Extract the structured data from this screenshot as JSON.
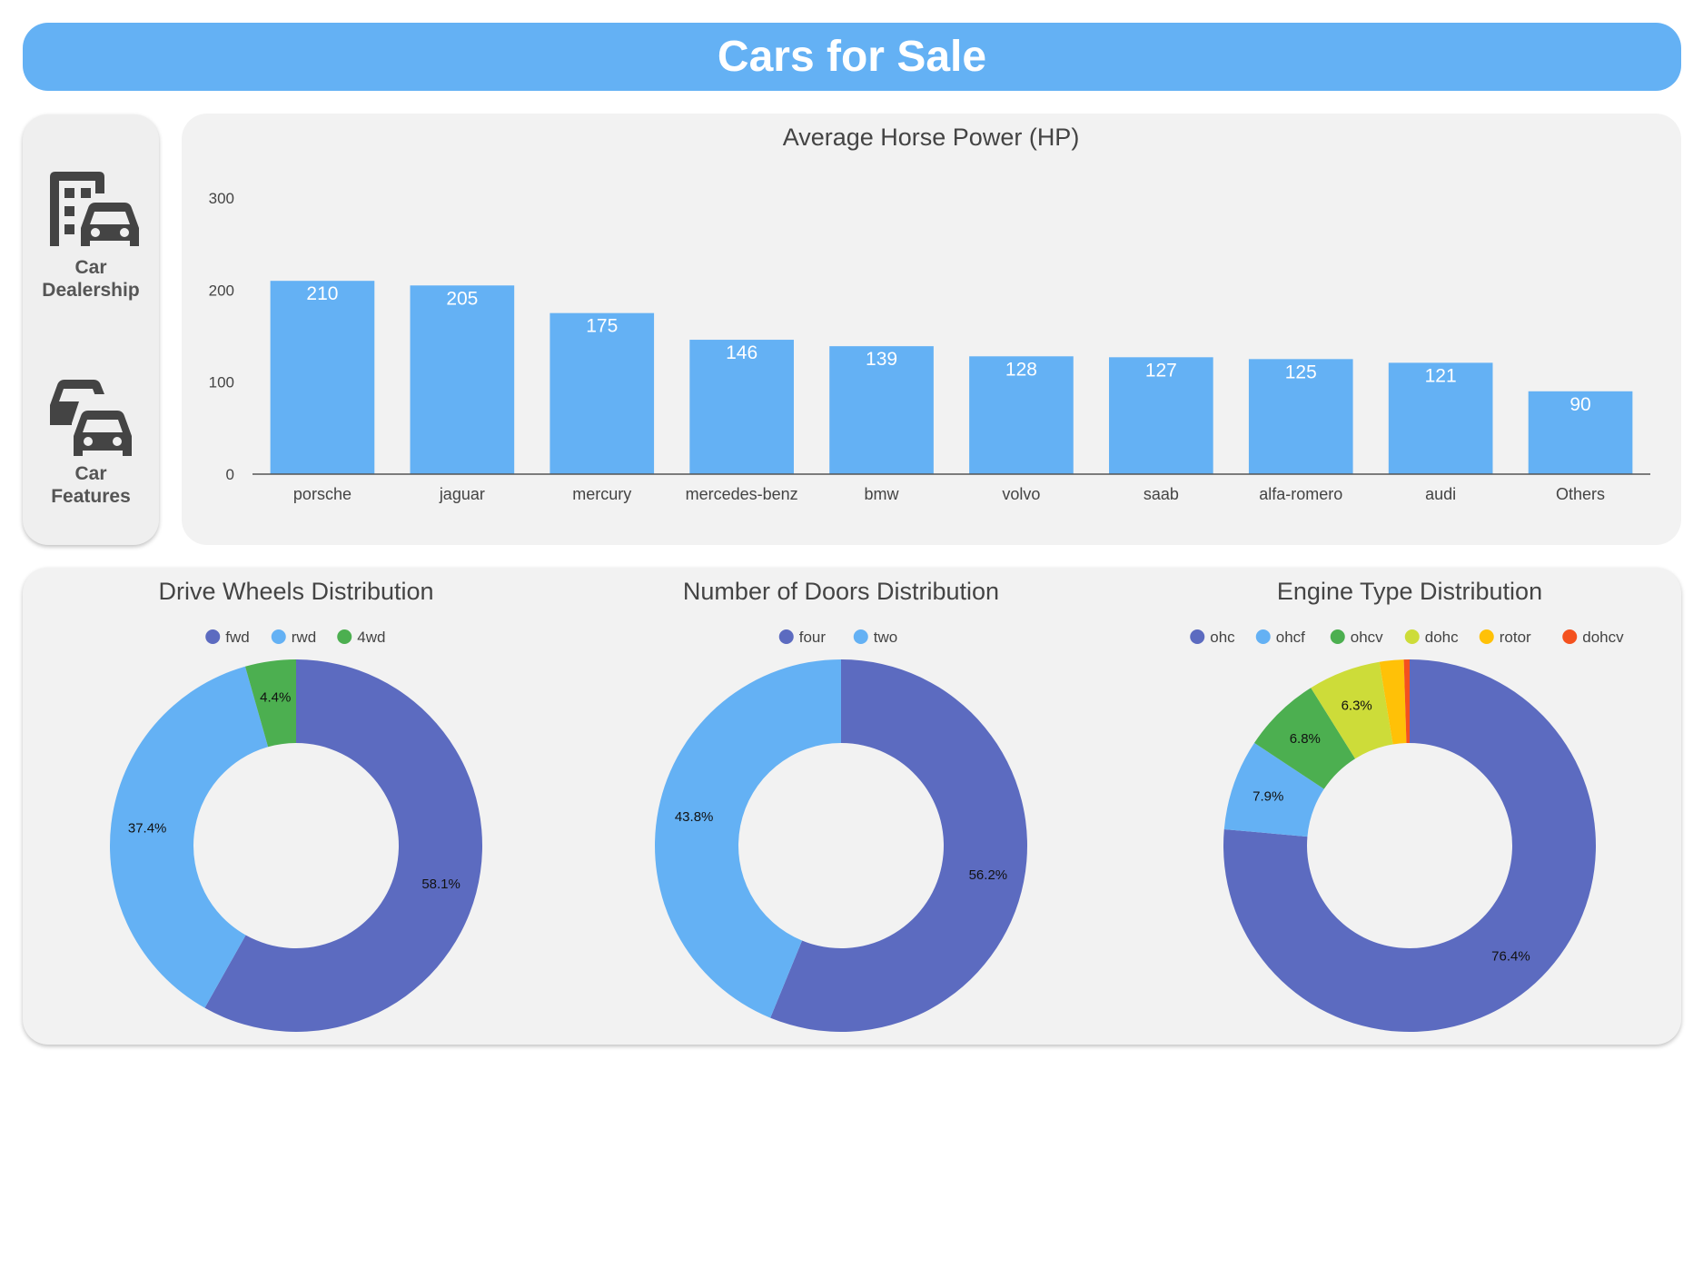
{
  "header": {
    "title": "Cars for Sale"
  },
  "sidebar": {
    "items": [
      {
        "label_line1": "Car",
        "label_line2": "Dealership",
        "icon": "building-car-icon"
      },
      {
        "label_line1": "Car",
        "label_line2": "Features",
        "icon": "cars-icon"
      }
    ]
  },
  "colors": {
    "accent": "#64b1f4",
    "bar": "#64b1f4",
    "panel": "#f2f2f2"
  },
  "chart_data": [
    {
      "type": "bar",
      "title": "Average Horse Power (HP)",
      "categories": [
        "porsche",
        "jaguar",
        "mercury",
        "mercedes-benz",
        "bmw",
        "volvo",
        "saab",
        "alfa-romero",
        "audi",
        "Others"
      ],
      "values": [
        210,
        205,
        175,
        146,
        139,
        128,
        127,
        125,
        121,
        90
      ],
      "ylim": [
        0,
        300
      ],
      "yticks": [
        0,
        100,
        200,
        300
      ],
      "data_labels": true,
      "grid": false,
      "color": "#64b1f4"
    },
    {
      "type": "pie",
      "donut": true,
      "title": "Drive Wheels Distribution",
      "legend_position": "top",
      "slices": [
        {
          "label": "fwd",
          "value": 58.1,
          "display": "58.1%",
          "color": "#5c6bc0"
        },
        {
          "label": "rwd",
          "value": 37.4,
          "display": "37.4%",
          "color": "#64b1f4"
        },
        {
          "label": "4wd",
          "value": 4.4,
          "display": "4.4%",
          "color": "#4caf50"
        }
      ]
    },
    {
      "type": "pie",
      "donut": true,
      "title": "Number of Doors Distribution",
      "legend_position": "top",
      "slices": [
        {
          "label": "four",
          "value": 56.2,
          "display": "56.2%",
          "color": "#5c6bc0"
        },
        {
          "label": "two",
          "value": 43.8,
          "display": "43.8%",
          "color": "#64b1f4"
        }
      ]
    },
    {
      "type": "pie",
      "donut": true,
      "title": "Engine Type Distribution",
      "legend_position": "top",
      "slices": [
        {
          "label": "ohc",
          "value": 76.4,
          "display": "76.4%",
          "color": "#5c6bc0"
        },
        {
          "label": "ohcf",
          "value": 7.9,
          "display": "7.9%",
          "color": "#64b1f4"
        },
        {
          "label": "ohcv",
          "value": 6.8,
          "display": "6.8%",
          "color": "#4caf50"
        },
        {
          "label": "dohc",
          "value": 6.3,
          "display": "6.3%",
          "color": "#cddc39"
        },
        {
          "label": "rotor",
          "value": 2.1,
          "display": "",
          "color": "#ffc107"
        },
        {
          "label": "dohcv",
          "value": 0.5,
          "display": "",
          "color": "#f4511e"
        }
      ]
    }
  ]
}
